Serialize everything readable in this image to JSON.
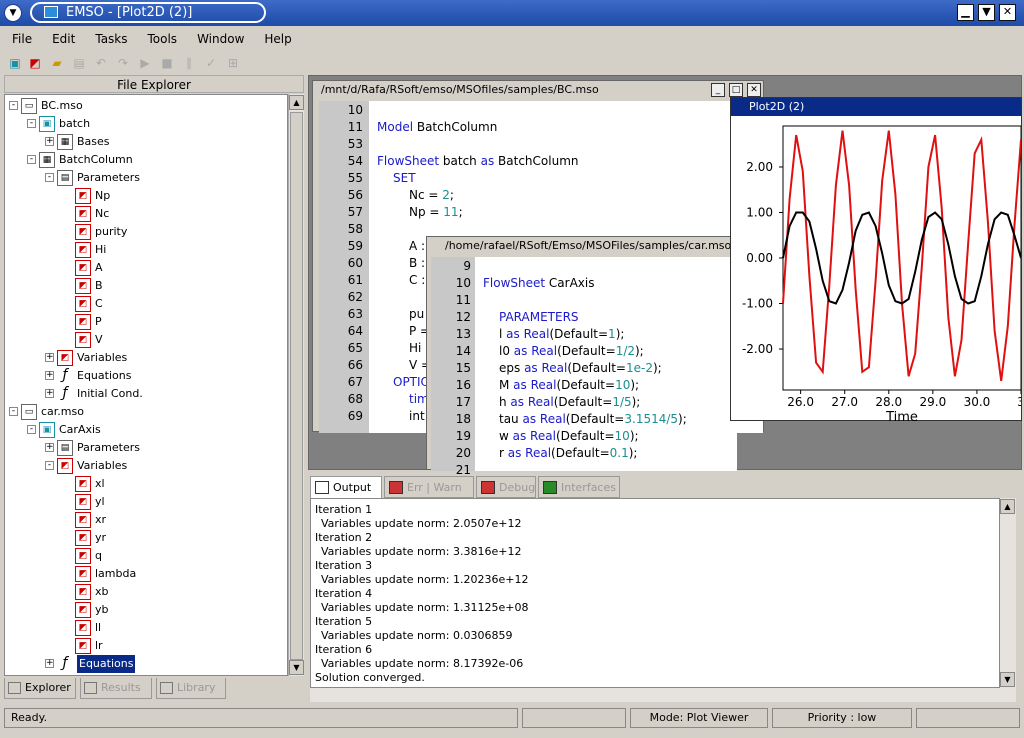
{
  "window": {
    "title": "EMSO - [Plot2D (2)]"
  },
  "menu": [
    "File",
    "Edit",
    "Tasks",
    "Tools",
    "Window",
    "Help"
  ],
  "explorer": {
    "title": "File Explorer",
    "rows": [
      {
        "label": "BC.mso",
        "level": 0,
        "exp": "-",
        "icon": "file"
      },
      {
        "label": "batch",
        "level": 1,
        "exp": "-",
        "icon": "model"
      },
      {
        "label": "Bases",
        "level": 2,
        "exp": "+",
        "icon": "flowsheet"
      },
      {
        "label": "BatchColumn",
        "level": 1,
        "exp": "-",
        "icon": "flowsheet"
      },
      {
        "label": "Parameters",
        "level": 2,
        "exp": "-",
        "icon": "params"
      },
      {
        "label": "Np",
        "level": 3,
        "icon": "var"
      },
      {
        "label": "Nc",
        "level": 3,
        "icon": "var"
      },
      {
        "label": "purity",
        "level": 3,
        "icon": "var"
      },
      {
        "label": "Hi",
        "level": 3,
        "icon": "var"
      },
      {
        "label": "A",
        "level": 3,
        "icon": "var"
      },
      {
        "label": "B",
        "level": 3,
        "icon": "var"
      },
      {
        "label": "C",
        "level": 3,
        "icon": "var"
      },
      {
        "label": "P",
        "level": 3,
        "icon": "var"
      },
      {
        "label": "V",
        "level": 3,
        "icon": "var"
      },
      {
        "label": "Variables",
        "level": 2,
        "exp": "+",
        "icon": "var"
      },
      {
        "label": "Equations",
        "level": 2,
        "exp": "+",
        "icon": "fx"
      },
      {
        "label": "Initial Cond.",
        "level": 2,
        "exp": "+",
        "icon": "fx"
      },
      {
        "label": "car.mso",
        "level": 0,
        "exp": "-",
        "icon": "file"
      },
      {
        "label": "CarAxis",
        "level": 1,
        "exp": "-",
        "icon": "model"
      },
      {
        "label": "Parameters",
        "level": 2,
        "exp": "+",
        "icon": "params"
      },
      {
        "label": "Variables",
        "level": 2,
        "exp": "-",
        "icon": "var"
      },
      {
        "label": "xl",
        "level": 3,
        "icon": "var"
      },
      {
        "label": "yl",
        "level": 3,
        "icon": "var"
      },
      {
        "label": "xr",
        "level": 3,
        "icon": "var"
      },
      {
        "label": "yr",
        "level": 3,
        "icon": "var"
      },
      {
        "label": "q",
        "level": 3,
        "icon": "var"
      },
      {
        "label": "lambda",
        "level": 3,
        "icon": "var"
      },
      {
        "label": "xb",
        "level": 3,
        "icon": "var"
      },
      {
        "label": "yb",
        "level": 3,
        "icon": "var"
      },
      {
        "label": "ll",
        "level": 3,
        "icon": "var"
      },
      {
        "label": "lr",
        "level": 3,
        "icon": "var"
      },
      {
        "label": "Equations",
        "level": 2,
        "exp": "+",
        "icon": "fx",
        "selected": true
      }
    ],
    "tabs": [
      "Explorer",
      "Results",
      "Library"
    ]
  },
  "bc_editor": {
    "title": "/mnt/d/Rafa/RSoft/emso/MSOfiles/samples/BC.mso",
    "lines": [
      {
        "n": "10",
        "t": ""
      },
      {
        "n": "11",
        "t": "Model BatchColumn",
        "kw": "Model",
        "rest": " BatchColumn"
      },
      {
        "n": "53",
        "t": ""
      },
      {
        "n": "54",
        "kw": "FlowSheet",
        "rest": " batch ",
        "kw2": "as",
        "rest2": " BatchColumn"
      },
      {
        "n": "55",
        "kw": "SET",
        "indent": 1
      },
      {
        "n": "56",
        "rest": "Nc = ",
        "num": "2",
        "tail": ";",
        "indent": 2
      },
      {
        "n": "57",
        "rest": "Np = ",
        "num": "11",
        "tail": ";",
        "indent": 2
      },
      {
        "n": "58",
        "t": ""
      },
      {
        "n": "59",
        "rest": "A :",
        "indent": 2
      },
      {
        "n": "60",
        "rest": "B :",
        "indent": 2
      },
      {
        "n": "61",
        "rest": "C :",
        "indent": 2
      },
      {
        "n": "62",
        "t": ""
      },
      {
        "n": "63",
        "rest": "pu",
        "indent": 2
      },
      {
        "n": "64",
        "rest": "P =",
        "indent": 2
      },
      {
        "n": "65",
        "rest": "Hi",
        "indent": 2
      },
      {
        "n": "66",
        "rest": "V =",
        "indent": 2
      },
      {
        "n": "67",
        "kw": "OPTIO",
        "indent": 1
      },
      {
        "n": "68",
        "kw": "tim",
        "indent": 2
      },
      {
        "n": "69",
        "rest": "int",
        "indent": 2
      }
    ]
  },
  "car_editor": {
    "title": "/home/rafael/RSoft/Emso/MSOFiles/samples/car.mso",
    "lines": [
      {
        "n": "9"
      },
      {
        "n": "10",
        "kw": "FlowSheet",
        "rest": " CarAxis",
        "fold": true
      },
      {
        "n": "11"
      },
      {
        "n": "12",
        "kw": "PARAMETERS",
        "indent": 1
      },
      {
        "n": "13",
        "rest": "l ",
        "kw": "as Real",
        "rest2": "(Default=",
        "num": "1",
        "tail": ");"
      },
      {
        "n": "14",
        "rest": "l0 ",
        "kw": "as Real",
        "rest2": "(Default=",
        "num": "1/2",
        "tail": ");"
      },
      {
        "n": "15",
        "rest": "eps ",
        "kw": "as Real",
        "rest2": "(Default=",
        "num": "1e-2",
        "tail": ");"
      },
      {
        "n": "16",
        "rest": "M ",
        "kw": "as Real",
        "rest2": "(Default=",
        "num": "10",
        "tail": ");"
      },
      {
        "n": "17",
        "rest": "h ",
        "kw": "as Real",
        "rest2": "(Default=",
        "num": "1/5",
        "tail": ");"
      },
      {
        "n": "18",
        "rest": "tau ",
        "kw": "as Real",
        "rest2": "(Default=",
        "num": "3.1514/5",
        "tail": ");"
      },
      {
        "n": "19",
        "rest": "w ",
        "kw": "as Real",
        "rest2": "(Default=",
        "num": "10",
        "tail": ");"
      },
      {
        "n": "20",
        "rest": "r ",
        "kw": "as Real",
        "rest2": "(Default=",
        "num": "0.1",
        "tail": ");"
      },
      {
        "n": "21"
      }
    ]
  },
  "plot": {
    "title": "Plot2D (2)",
    "xlabel": "Time",
    "xticks": [
      "26.0",
      "27.0",
      "28.0",
      "29.0",
      "30.0",
      "3"
    ],
    "yticks": [
      "2.00",
      "1.00",
      "0.00",
      "-1.00",
      "-2.00"
    ],
    "colors": {
      "series1": "#e01010",
      "series2": "#000000"
    }
  },
  "chart_data": {
    "type": "line",
    "xlabel": "Time",
    "xlim": [
      25.6,
      31.0
    ],
    "ylim": [
      -2.9,
      2.9
    ],
    "series": [
      {
        "color": "#e01010",
        "x": [
          25.6,
          25.75,
          25.9,
          26.05,
          26.2,
          26.35,
          26.5,
          26.65,
          26.8,
          26.95,
          27.1,
          27.25,
          27.4,
          27.55,
          27.7,
          27.85,
          28.0,
          28.15,
          28.3,
          28.45,
          28.6,
          28.75,
          28.9,
          29.05,
          29.2,
          29.35,
          29.5,
          29.65,
          29.8,
          29.95,
          30.1,
          30.25,
          30.4,
          30.55,
          30.7,
          30.85,
          31.0
        ],
        "y": [
          -1.0,
          1.3,
          2.7,
          1.9,
          -0.4,
          -2.3,
          -2.5,
          -0.6,
          1.6,
          2.8,
          1.6,
          -0.7,
          -2.5,
          -2.4,
          -0.5,
          1.7,
          2.8,
          1.4,
          -1.0,
          -2.6,
          -2.1,
          -0.2,
          2.0,
          2.7,
          1.1,
          -1.3,
          -2.6,
          -1.8,
          0.3,
          2.3,
          2.6,
          0.8,
          -1.6,
          -2.7,
          -1.5,
          0.7,
          2.6
        ]
      },
      {
        "color": "#000000",
        "x": [
          25.6,
          25.75,
          25.9,
          26.05,
          26.2,
          26.35,
          26.5,
          26.65,
          26.8,
          26.95,
          27.1,
          27.25,
          27.4,
          27.55,
          27.7,
          27.85,
          28.0,
          28.15,
          28.3,
          28.45,
          28.6,
          28.75,
          28.9,
          29.05,
          29.2,
          29.35,
          29.5,
          29.65,
          29.8,
          29.95,
          30.1,
          30.25,
          30.4,
          30.55,
          30.7,
          30.85,
          31.0
        ],
        "y": [
          0.0,
          0.7,
          1.0,
          1.0,
          0.8,
          0.2,
          -0.5,
          -0.95,
          -1.0,
          -0.7,
          -0.1,
          0.6,
          0.95,
          1.0,
          0.7,
          0.1,
          -0.6,
          -0.95,
          -1.0,
          -0.9,
          -0.3,
          0.4,
          0.9,
          1.0,
          0.85,
          0.3,
          -0.4,
          -0.9,
          -1.0,
          -0.95,
          -0.4,
          0.3,
          0.85,
          1.0,
          0.95,
          0.5,
          0.0
        ]
      }
    ]
  },
  "output": {
    "tabs": [
      "Output",
      "Err | Warn",
      "Debug",
      "Interfaces"
    ],
    "lines": [
      "Iteration 1",
      "Variables update norm: 2.0507e+12",
      "Iteration 2",
      "Variables update norm: 3.3816e+12",
      "Iteration 3",
      "Variables update norm: 1.20236e+12",
      "Iteration 4",
      "Variables update norm: 1.31125e+08",
      "Iteration 5",
      "Variables update norm: 0.0306859",
      "Iteration 6",
      "Variables update norm: 8.17392e-06",
      "Solution converged."
    ]
  },
  "status": {
    "ready": "Ready.",
    "mode": "Mode: Plot Viewer",
    "priority": "Priority : low"
  }
}
